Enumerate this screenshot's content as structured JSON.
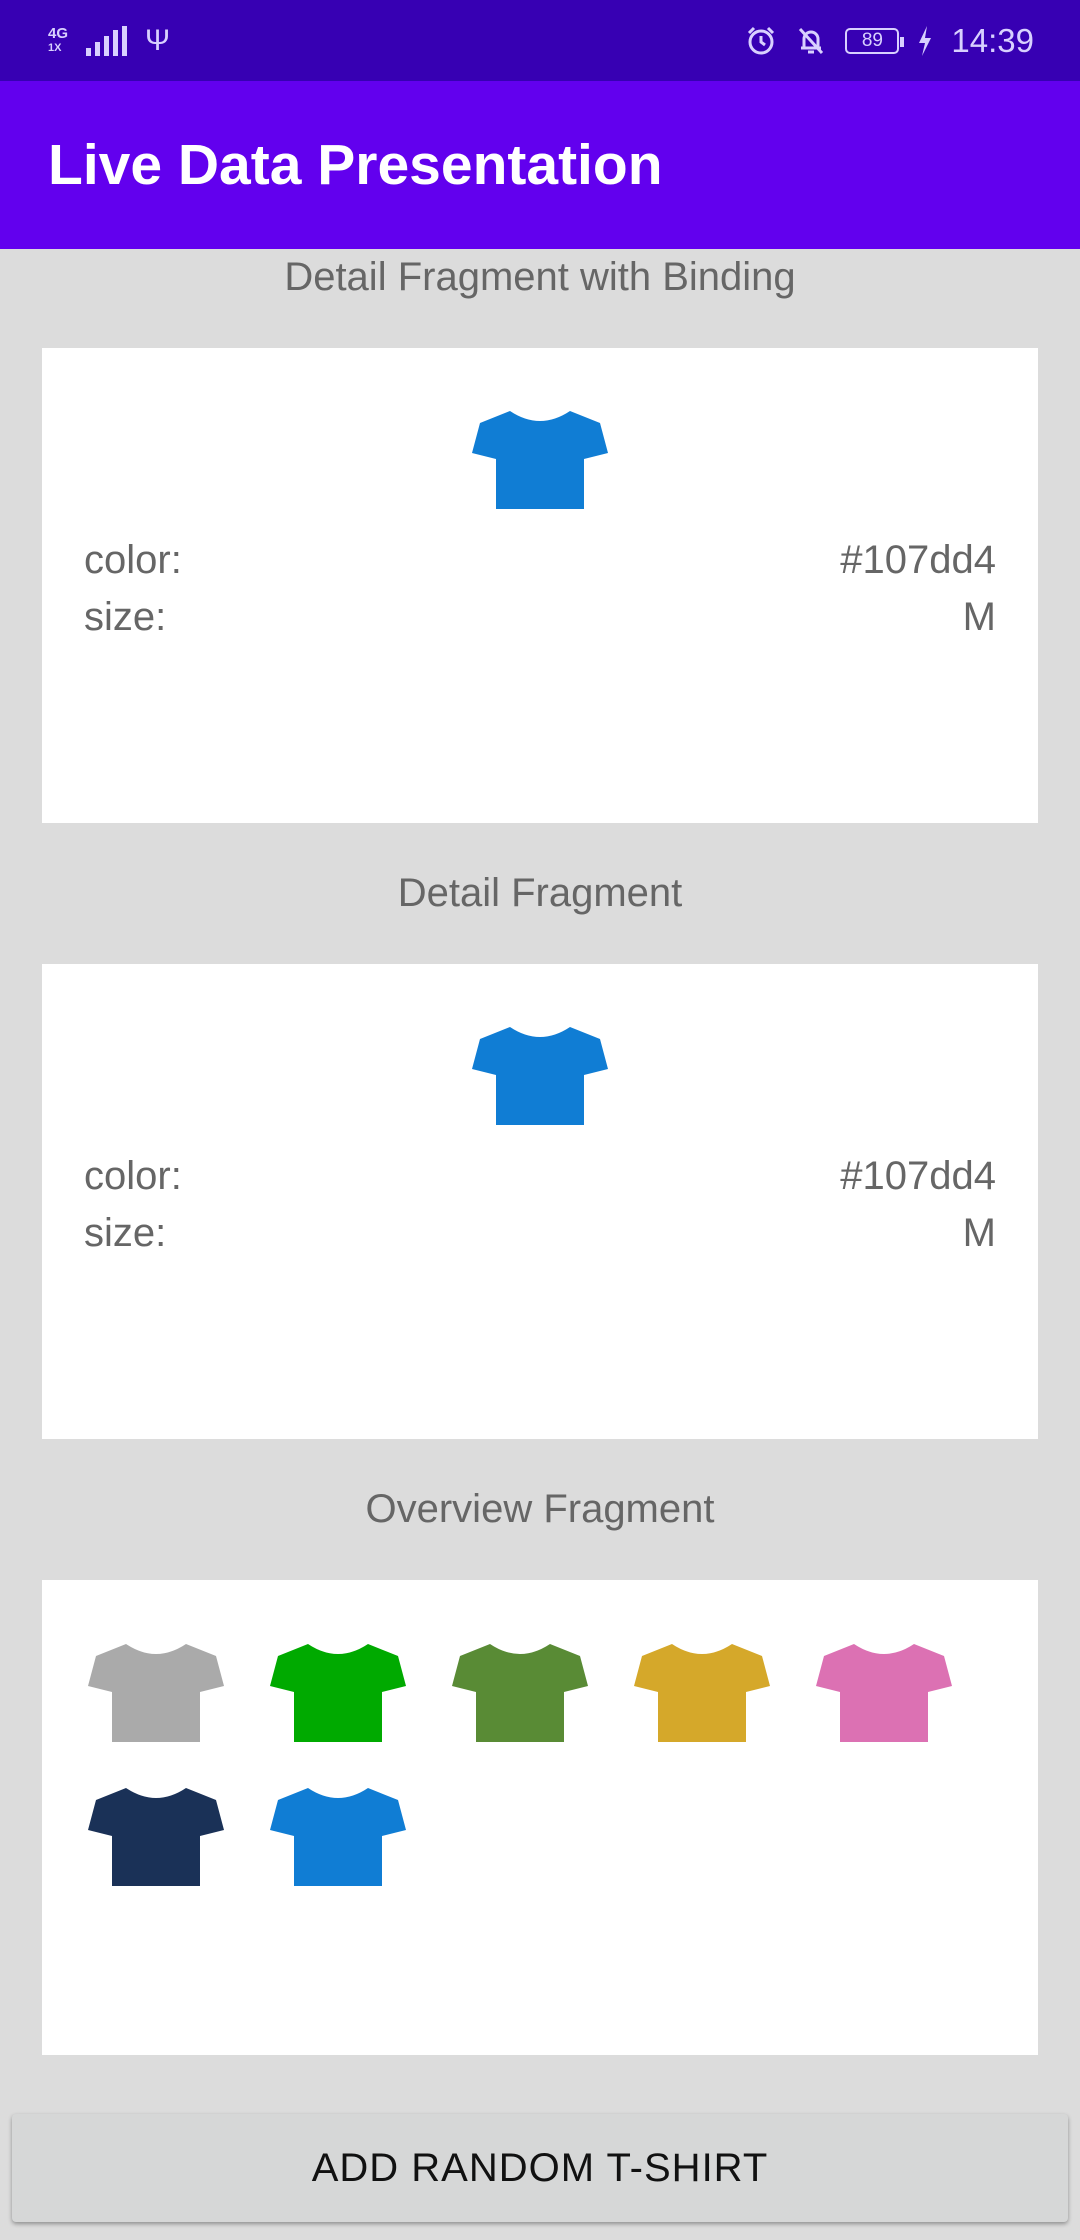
{
  "status_bar": {
    "network": "4G",
    "network_sub": "1X",
    "battery_level": "89",
    "time": "14:39",
    "icons": [
      "signal-icon",
      "usb-icon",
      "alarm-icon",
      "notifications-off-icon",
      "battery-icon",
      "charging-icon"
    ]
  },
  "app_bar": {
    "title": "Live Data Presentation",
    "color": "#6200ee"
  },
  "detail_binding": {
    "title": "Detail Fragment with Binding",
    "shirt_color": "#107dd4",
    "color_label": "color:",
    "color_value": "#107dd4",
    "size_label": "size:",
    "size_value": "M"
  },
  "detail": {
    "title": "Detail Fragment",
    "shirt_color": "#107dd4",
    "color_label": "color:",
    "color_value": "#107dd4",
    "size_label": "size:",
    "size_value": "M"
  },
  "overview": {
    "title": "Overview Fragment",
    "shirt_colors": [
      "#aaaaaa",
      "#00aa00",
      "#598b35",
      "#d5a82a",
      "#dc71b3",
      "#1a3157",
      "#107dd4"
    ]
  },
  "add_button": {
    "label": "ADD RANDOM T-SHIRT"
  }
}
